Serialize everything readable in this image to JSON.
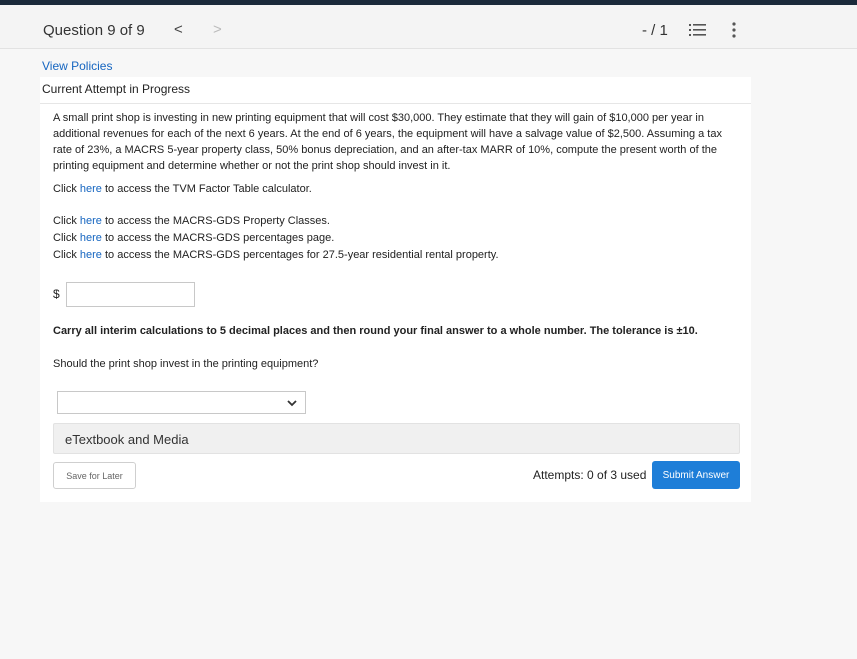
{
  "header": {
    "question_label": "Question 9 of 9",
    "prev": "<",
    "next": ">",
    "score": "- / 1"
  },
  "view_policies": "View Policies",
  "attempt_status": "Current Attempt in Progress",
  "question_text": "A small print shop is investing in new printing equipment that will cost $30,000. They estimate that they will gain of $10,000 per year in additional revenues for each of the next 6 years. At the end of 6 years, the equipment will have a salvage value of $2,500. Assuming a tax rate of 23%, a MACRS 5-year property class, 50% bonus depreciation, and an after-tax MARR of 10%, compute the present worth of the printing equipment and determine whether or not the print shop should invest in it.",
  "links": [
    {
      "pre": "Click ",
      "link": "here",
      "post": " to access the TVM Factor Table calculator."
    },
    {
      "pre": "Click ",
      "link": "here",
      "post": " to access the MACRS-GDS Property Classes."
    },
    {
      "pre": "Click ",
      "link": "here",
      "post": " to access the MACRS-GDS percentages page."
    },
    {
      "pre": "Click ",
      "link": "here",
      "post": " to access the MACRS-GDS percentages for 27.5-year residential rental property."
    }
  ],
  "answer": {
    "currency": "$",
    "value": ""
  },
  "instructions": "Carry all interim calculations to 5 decimal places and then round your final answer to a whole number. The tolerance is ±10.",
  "invest_question": "Should the print shop invest in the printing equipment?",
  "select": {
    "value": ""
  },
  "etextbook": "eTextbook and Media",
  "save_label": "Save for Later",
  "attempts": "Attempts: 0 of 3 used",
  "submit_label": "Submit Answer",
  "colors": {
    "link": "#1565c0",
    "submit": "#1e7ed8",
    "topbar": "#1b2a3a"
  }
}
